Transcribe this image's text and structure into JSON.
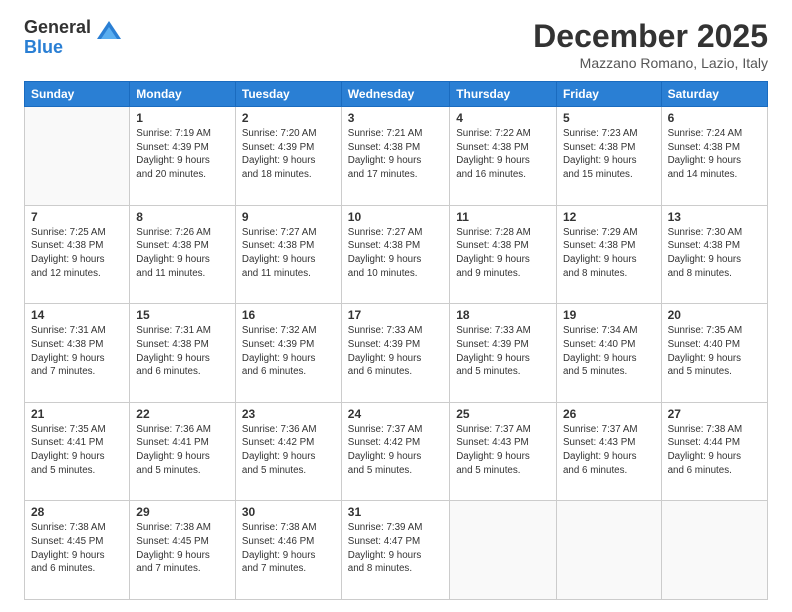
{
  "logo": {
    "general": "General",
    "blue": "Blue"
  },
  "title": "December 2025",
  "location": "Mazzano Romano, Lazio, Italy",
  "weekdays": [
    "Sunday",
    "Monday",
    "Tuesday",
    "Wednesday",
    "Thursday",
    "Friday",
    "Saturday"
  ],
  "weeks": [
    [
      {
        "day": "",
        "info": ""
      },
      {
        "day": "1",
        "info": "Sunrise: 7:19 AM\nSunset: 4:39 PM\nDaylight: 9 hours\nand 20 minutes."
      },
      {
        "day": "2",
        "info": "Sunrise: 7:20 AM\nSunset: 4:39 PM\nDaylight: 9 hours\nand 18 minutes."
      },
      {
        "day": "3",
        "info": "Sunrise: 7:21 AM\nSunset: 4:38 PM\nDaylight: 9 hours\nand 17 minutes."
      },
      {
        "day": "4",
        "info": "Sunrise: 7:22 AM\nSunset: 4:38 PM\nDaylight: 9 hours\nand 16 minutes."
      },
      {
        "day": "5",
        "info": "Sunrise: 7:23 AM\nSunset: 4:38 PM\nDaylight: 9 hours\nand 15 minutes."
      },
      {
        "day": "6",
        "info": "Sunrise: 7:24 AM\nSunset: 4:38 PM\nDaylight: 9 hours\nand 14 minutes."
      }
    ],
    [
      {
        "day": "7",
        "info": "Sunrise: 7:25 AM\nSunset: 4:38 PM\nDaylight: 9 hours\nand 12 minutes."
      },
      {
        "day": "8",
        "info": "Sunrise: 7:26 AM\nSunset: 4:38 PM\nDaylight: 9 hours\nand 11 minutes."
      },
      {
        "day": "9",
        "info": "Sunrise: 7:27 AM\nSunset: 4:38 PM\nDaylight: 9 hours\nand 11 minutes."
      },
      {
        "day": "10",
        "info": "Sunrise: 7:27 AM\nSunset: 4:38 PM\nDaylight: 9 hours\nand 10 minutes."
      },
      {
        "day": "11",
        "info": "Sunrise: 7:28 AM\nSunset: 4:38 PM\nDaylight: 9 hours\nand 9 minutes."
      },
      {
        "day": "12",
        "info": "Sunrise: 7:29 AM\nSunset: 4:38 PM\nDaylight: 9 hours\nand 8 minutes."
      },
      {
        "day": "13",
        "info": "Sunrise: 7:30 AM\nSunset: 4:38 PM\nDaylight: 9 hours\nand 8 minutes."
      }
    ],
    [
      {
        "day": "14",
        "info": "Sunrise: 7:31 AM\nSunset: 4:38 PM\nDaylight: 9 hours\nand 7 minutes."
      },
      {
        "day": "15",
        "info": "Sunrise: 7:31 AM\nSunset: 4:38 PM\nDaylight: 9 hours\nand 6 minutes."
      },
      {
        "day": "16",
        "info": "Sunrise: 7:32 AM\nSunset: 4:39 PM\nDaylight: 9 hours\nand 6 minutes."
      },
      {
        "day": "17",
        "info": "Sunrise: 7:33 AM\nSunset: 4:39 PM\nDaylight: 9 hours\nand 6 minutes."
      },
      {
        "day": "18",
        "info": "Sunrise: 7:33 AM\nSunset: 4:39 PM\nDaylight: 9 hours\nand 5 minutes."
      },
      {
        "day": "19",
        "info": "Sunrise: 7:34 AM\nSunset: 4:40 PM\nDaylight: 9 hours\nand 5 minutes."
      },
      {
        "day": "20",
        "info": "Sunrise: 7:35 AM\nSunset: 4:40 PM\nDaylight: 9 hours\nand 5 minutes."
      }
    ],
    [
      {
        "day": "21",
        "info": "Sunrise: 7:35 AM\nSunset: 4:41 PM\nDaylight: 9 hours\nand 5 minutes."
      },
      {
        "day": "22",
        "info": "Sunrise: 7:36 AM\nSunset: 4:41 PM\nDaylight: 9 hours\nand 5 minutes."
      },
      {
        "day": "23",
        "info": "Sunrise: 7:36 AM\nSunset: 4:42 PM\nDaylight: 9 hours\nand 5 minutes."
      },
      {
        "day": "24",
        "info": "Sunrise: 7:37 AM\nSunset: 4:42 PM\nDaylight: 9 hours\nand 5 minutes."
      },
      {
        "day": "25",
        "info": "Sunrise: 7:37 AM\nSunset: 4:43 PM\nDaylight: 9 hours\nand 5 minutes."
      },
      {
        "day": "26",
        "info": "Sunrise: 7:37 AM\nSunset: 4:43 PM\nDaylight: 9 hours\nand 6 minutes."
      },
      {
        "day": "27",
        "info": "Sunrise: 7:38 AM\nSunset: 4:44 PM\nDaylight: 9 hours\nand 6 minutes."
      }
    ],
    [
      {
        "day": "28",
        "info": "Sunrise: 7:38 AM\nSunset: 4:45 PM\nDaylight: 9 hours\nand 6 minutes."
      },
      {
        "day": "29",
        "info": "Sunrise: 7:38 AM\nSunset: 4:45 PM\nDaylight: 9 hours\nand 7 minutes."
      },
      {
        "day": "30",
        "info": "Sunrise: 7:38 AM\nSunset: 4:46 PM\nDaylight: 9 hours\nand 7 minutes."
      },
      {
        "day": "31",
        "info": "Sunrise: 7:39 AM\nSunset: 4:47 PM\nDaylight: 9 hours\nand 8 minutes."
      },
      {
        "day": "",
        "info": ""
      },
      {
        "day": "",
        "info": ""
      },
      {
        "day": "",
        "info": ""
      }
    ]
  ]
}
